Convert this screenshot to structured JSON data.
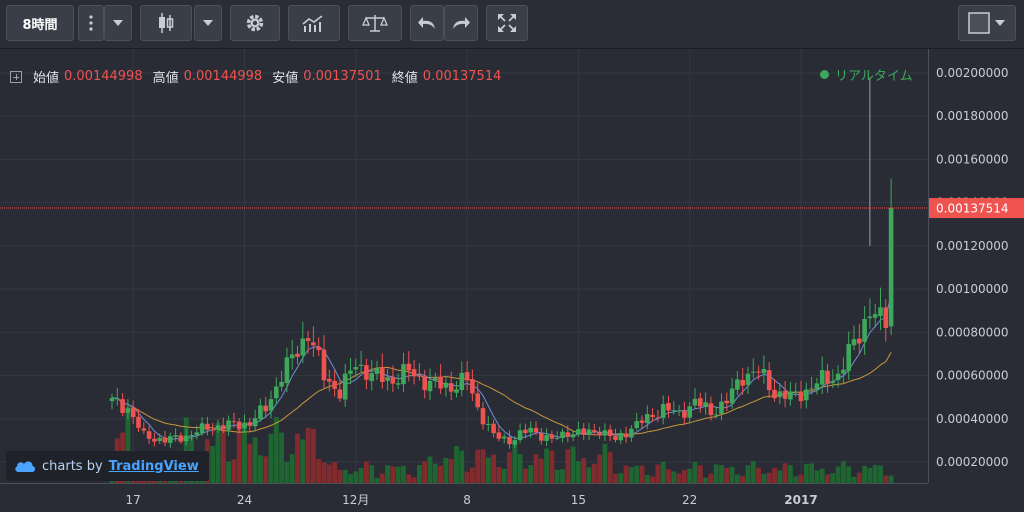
{
  "toolbar": {
    "interval_label": "8時間",
    "icons": [
      "more-vertical-icon",
      "caret-down-icon",
      "candlestick-icon",
      "caret-down-icon",
      "gear-icon",
      "indicators-icon",
      "compare-scale-icon",
      "undo-icon",
      "redo-icon",
      "fullscreen-icon",
      "layout-square-icon"
    ]
  },
  "legend": {
    "open_label": "始値",
    "open_value": "0.00144998",
    "high_label": "高値",
    "high_value": "0.00144998",
    "low_label": "安値",
    "low_value": "0.00137501",
    "close_label": "終値",
    "close_value": "0.00137514"
  },
  "realtime_label": "リアルタイム",
  "watermark": {
    "prefix": "charts by",
    "brand": "TradingView"
  },
  "colors": {
    "up": "#3ea85a",
    "down": "#ef5350",
    "ma_fast": "#6f8fd8",
    "ma_slow": "#c8963e",
    "price_label_bg": "#ef5350"
  },
  "chart_data": {
    "type": "candlestick",
    "y_axis": {
      "min": 0.0001,
      "max": 0.0021,
      "ticks": [
        "0.00020000",
        "0.00040000",
        "0.00060000",
        "0.00080000",
        "0.00100000",
        "0.00120000",
        "0.00140000",
        "0.00160000",
        "0.00180000",
        "0.00200000"
      ]
    },
    "x_axis": {
      "ticks": [
        {
          "label": "17",
          "index": 4
        },
        {
          "label": "24",
          "index": 25
        },
        {
          "label": "12月",
          "index": 46
        },
        {
          "label": "8",
          "index": 67
        },
        {
          "label": "15",
          "index": 88
        },
        {
          "label": "22",
          "index": 109
        },
        {
          "label": "2017",
          "index": 130
        }
      ]
    },
    "current_price": "0.00137514",
    "candles_count": 148,
    "anchors": [
      [
        0,
        0.00048
      ],
      [
        3,
        0.00045
      ],
      [
        6,
        0.00032
      ],
      [
        10,
        0.0003
      ],
      [
        14,
        0.00032
      ],
      [
        18,
        0.00036
      ],
      [
        22,
        0.00037
      ],
      [
        26,
        0.00038
      ],
      [
        29,
        0.00045
      ],
      [
        32,
        0.0006
      ],
      [
        35,
        0.00072
      ],
      [
        37,
        0.0008
      ],
      [
        40,
        0.0006
      ],
      [
        43,
        0.00052
      ],
      [
        46,
        0.00066
      ],
      [
        49,
        0.0006
      ],
      [
        53,
        0.00058
      ],
      [
        56,
        0.00062
      ],
      [
        60,
        0.00056
      ],
      [
        64,
        0.00055
      ],
      [
        67,
        0.00058
      ],
      [
        69,
        0.00045
      ],
      [
        72,
        0.00032
      ],
      [
        75,
        0.0003
      ],
      [
        79,
        0.00035
      ],
      [
        83,
        0.0003
      ],
      [
        86,
        0.00034
      ],
      [
        89,
        0.00033
      ],
      [
        92,
        0.00035
      ],
      [
        95,
        0.0003
      ],
      [
        98,
        0.00036
      ],
      [
        101,
        0.0004
      ],
      [
        104,
        0.00045
      ],
      [
        107,
        0.00042
      ],
      [
        110,
        0.00048
      ],
      [
        113,
        0.00043
      ],
      [
        116,
        0.00048
      ],
      [
        119,
        0.0006
      ],
      [
        122,
        0.00062
      ],
      [
        125,
        0.00052
      ],
      [
        128,
        0.0005
      ],
      [
        131,
        0.00053
      ],
      [
        134,
        0.00058
      ],
      [
        137,
        0.0006
      ],
      [
        139,
        0.0007
      ],
      [
        141,
        0.0008
      ],
      [
        143,
        0.0009
      ],
      [
        145,
        0.00085
      ],
      [
        147,
        0.00087
      ],
      [
        149,
        0.001
      ],
      [
        150,
        0.0012
      ],
      [
        151,
        0.0015
      ],
      [
        152,
        0.0014
      ],
      [
        153,
        0.00138
      ]
    ],
    "volume_scale_max": 1.0,
    "ma_fast_period": 5,
    "ma_slow_period": 20
  }
}
